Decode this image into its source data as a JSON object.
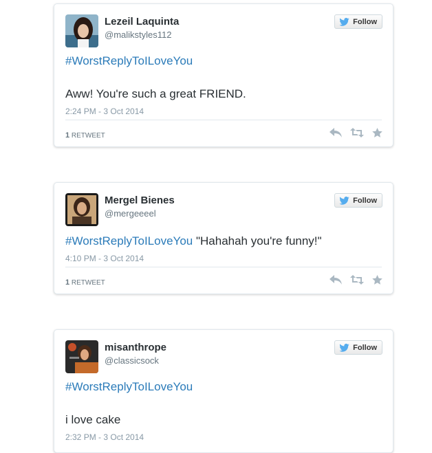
{
  "colors": {
    "hashtag": "#2b7bb9",
    "text": "#292f33",
    "meta": "#8899a6",
    "bird": "#55acee"
  },
  "tweets": [
    {
      "name": "Lezeil Laquinta",
      "handle": "@malikstyles112",
      "follow_label": "Follow",
      "hashtag": "#WorstReplyToILoveYou",
      "text": "Aww! You're such a great FRIEND.",
      "timestamp": "2:24 PM - 3 Oct 2014",
      "retweet_count": "1",
      "retweet_label": "RETWEET",
      "icons": [
        "reply-icon",
        "retweet-icon",
        "favorite-icon"
      ]
    },
    {
      "name": "Mergel Bienes",
      "handle": "@mergeeeel",
      "follow_label": "Follow",
      "hashtag": "#WorstReplyToILoveYou",
      "text": "\"Hahahah you're funny!\"",
      "timestamp": "4:10 PM - 3 Oct 2014",
      "retweet_count": "1",
      "retweet_label": "RETWEET",
      "icons": [
        "reply-icon",
        "retweet-icon",
        "favorite-icon"
      ]
    },
    {
      "name": "misanthrope",
      "handle": "@classicsock",
      "follow_label": "Follow",
      "hashtag": "#WorstReplyToILoveYou",
      "text": "i love cake",
      "timestamp": "2:32 PM - 3 Oct 2014"
    }
  ]
}
